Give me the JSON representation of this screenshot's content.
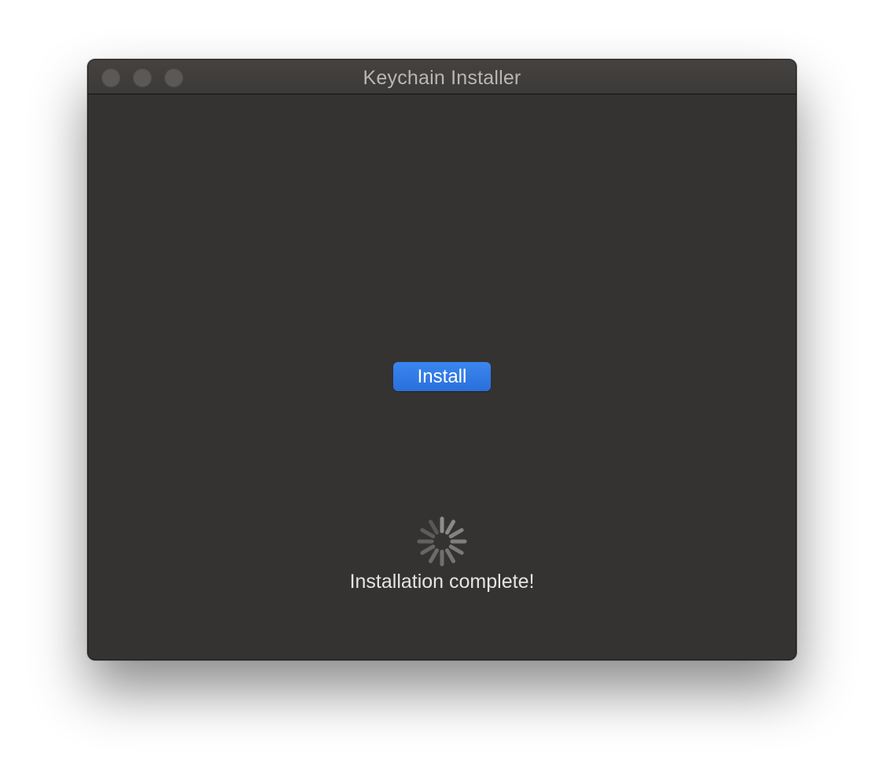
{
  "window": {
    "title": "Keychain Installer"
  },
  "main": {
    "install_button_label": "Install",
    "status_text": "Installation complete!"
  },
  "icons": {
    "close": "close-icon",
    "minimize": "minimize-icon",
    "zoom": "zoom-icon",
    "spinner": "loading-spinner-icon"
  },
  "colors": {
    "accent": "#2f7ae5",
    "window_background": "#353332",
    "titlebar": "#423f3d"
  }
}
